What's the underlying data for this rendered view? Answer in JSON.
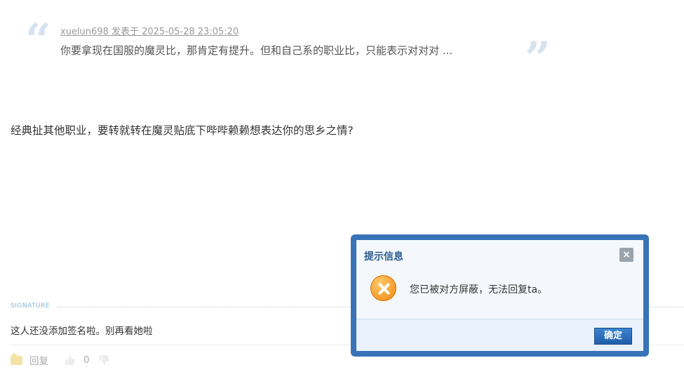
{
  "quote": {
    "author_line": "xuelun698 发表于 2025-05-28 23:05:20",
    "text": "你要拿现在国服的魔灵比，那肯定有提升。但和自己系的职业比，只能表示对对对 ...",
    "open_mark": "“",
    "close_mark": "”"
  },
  "post": {
    "body": "经典扯其他职业，要转就转在魔灵贴底下哔哔赖赖想表达你的思乡之情?"
  },
  "signature": {
    "label": "SIGNATURE",
    "text": "这人还没添加签名啦。别再看她啦"
  },
  "actions": {
    "reply_label": "回复",
    "like_count": "0"
  },
  "dialog": {
    "title": "提示信息",
    "close_symbol": "×",
    "message": "您已被对方屏蔽，无法回复ta。",
    "ok_label": "确定"
  },
  "icons": {
    "quote": "quote-mark-icon",
    "reply": "reply-icon",
    "like": "thumbs-up-icon",
    "dislike": "thumbs-down-icon",
    "error": "error-x-icon",
    "close": "close-icon"
  },
  "colors": {
    "dialog_border": "#3873b8",
    "dialog_title": "#2a5b8e",
    "ok_button": "#2a6ab8",
    "error_icon": "#f08a10"
  }
}
